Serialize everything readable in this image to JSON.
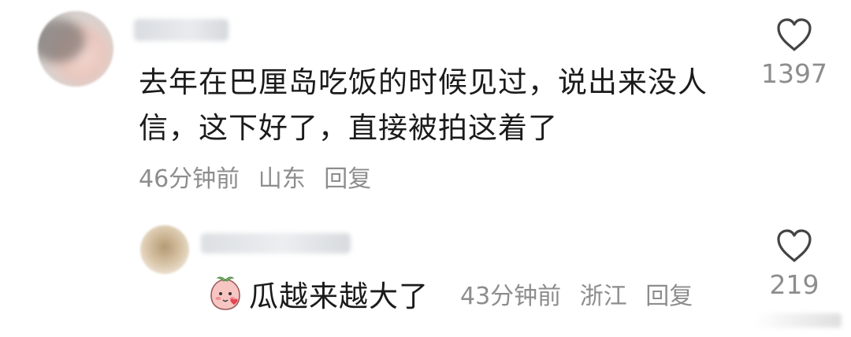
{
  "comment": {
    "text": "去年在巴厘岛吃饭的时候见过，说出来没人信，这下好了，直接被拍这着了",
    "time": "46分钟前",
    "location": "山东",
    "reply_label": "回复",
    "like_icon": "heart-outline-icon",
    "likes": "1397"
  },
  "reply": {
    "emoji": "peach-face-emoji",
    "text": "瓜越来越大了",
    "time": "43分钟前",
    "location": "浙江",
    "reply_label": "回复",
    "like_icon": "heart-outline-icon",
    "likes": "219"
  },
  "colors": {
    "text": "#1b1b1b",
    "meta": "#8d8d8d",
    "background": "#ffffff"
  }
}
